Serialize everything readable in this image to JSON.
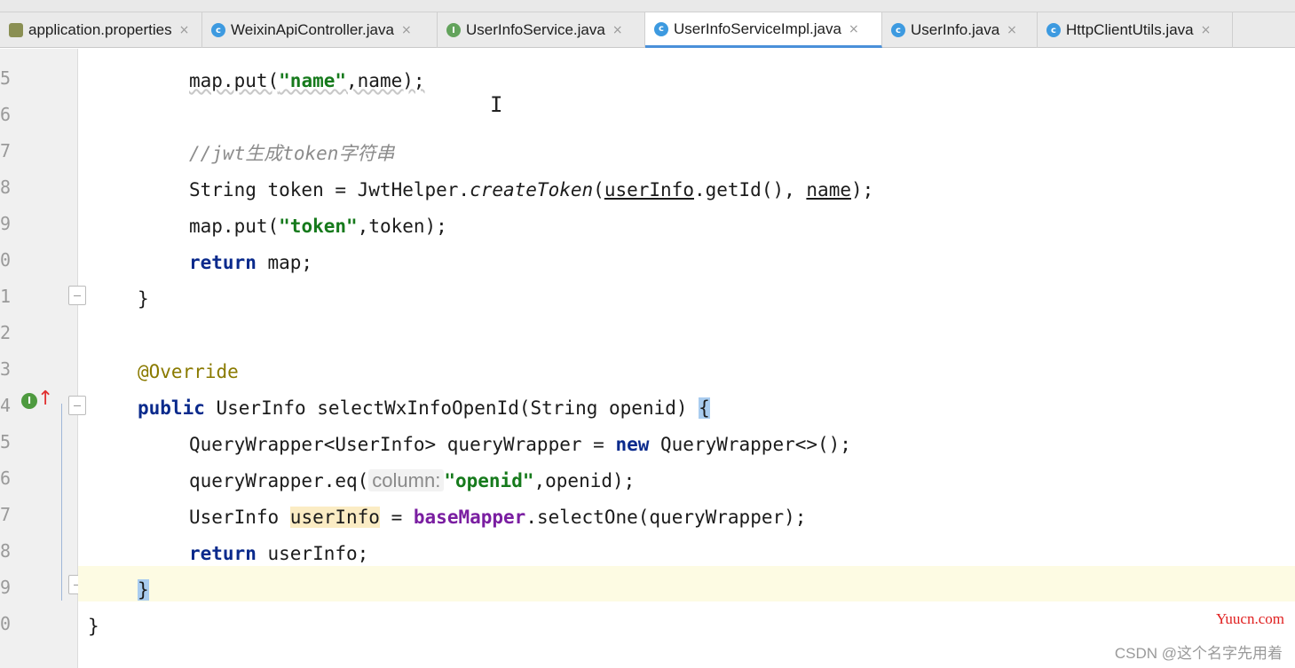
{
  "tabs": [
    {
      "label": "application.properties",
      "icon": "properties-file-icon"
    },
    {
      "label": "WeixinApiController.java",
      "icon": "class-icon"
    },
    {
      "label": "UserInfoService.java",
      "icon": "interface-icon"
    },
    {
      "label": "UserInfoServiceImpl.java",
      "icon": "class-icon",
      "active": true
    },
    {
      "label": "UserInfo.java",
      "icon": "class-icon"
    },
    {
      "label": "HttpClientUtils.java",
      "icon": "class-icon"
    }
  ],
  "tab_close_glyph": "×",
  "line_numbers": [
    "5",
    "6",
    "7",
    "8",
    "9",
    "0",
    "1",
    "2",
    "3",
    "4",
    "5",
    "6",
    "7",
    "8",
    "9",
    "0"
  ],
  "code": {
    "l1": {
      "a": "map.put(",
      "s": "\"name\"",
      "b": ",name);"
    },
    "l3": {
      "c": "//jwt生成token字符串"
    },
    "l4": {
      "a": "String token = JwtHelper.",
      "m": "createToken",
      "b": "(",
      "v": "userInfo",
      "d": ".getId(), ",
      "n": "name",
      "e": ");"
    },
    "l5": {
      "a": "map.put(",
      "s": "\"token\"",
      "b": ",token);"
    },
    "l6": {
      "k": "return",
      "b": " map;"
    },
    "l7": {
      "b": "}"
    },
    "l9": {
      "an": "@Override"
    },
    "l10": {
      "k": "public",
      "b": " UserInfo selectWxInfoOpenId(String openid) ",
      "br": "{"
    },
    "l11": {
      "a": "QueryWrapper<UserInfo> queryWrapper = ",
      "k": "new",
      "b": " QueryWrapper<>();"
    },
    "l12": {
      "a": "queryWrapper.eq(",
      "h": "column:",
      "s": "\"openid\"",
      "b": ",openid);"
    },
    "l13": {
      "a": "UserInfo ",
      "v": "userInfo",
      "b": " = ",
      "f": "baseMapper",
      "c": ".selectOne(queryWrapper);"
    },
    "l14": {
      "k": "return",
      "b": " userInfo;"
    },
    "l15": {
      "br": "}"
    },
    "l16": {
      "b": "}"
    }
  },
  "gutter_impl_badge": "I",
  "gutter_override_arrow": "↑",
  "text_cursor": "I",
  "watermark_site": "Yuucn.com",
  "watermark_author": "CSDN @这个名字先用着"
}
